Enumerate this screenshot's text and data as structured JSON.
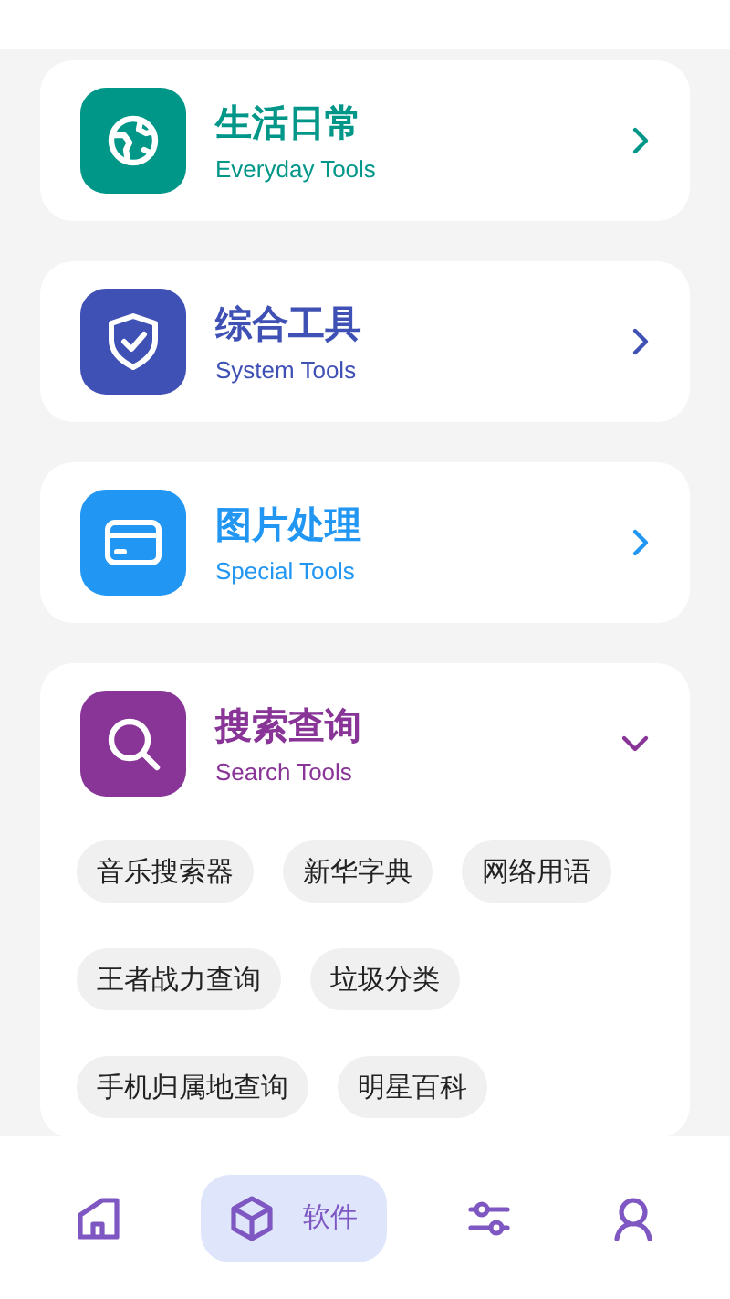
{
  "categories": [
    {
      "kind": "globe",
      "title": "生活日常",
      "subtitle": "Everyday Tools",
      "color": "#009688",
      "expanded": false
    },
    {
      "kind": "shield",
      "title": "综合工具",
      "subtitle": "System Tools",
      "color": "#3f51b5",
      "expanded": false
    },
    {
      "kind": "card",
      "title": "图片处理",
      "subtitle": "Special Tools",
      "color": "#2196f3",
      "expanded": false
    },
    {
      "kind": "search",
      "title": "搜索查询",
      "subtitle": "Search Tools",
      "color": "#883597",
      "expanded": true,
      "tools": [
        "音乐搜索器",
        "新华字典",
        "网络用语",
        "王者战力查询",
        "垃圾分类",
        "手机归属地查询",
        "明星百科"
      ]
    }
  ],
  "nav": [
    {
      "kind": "home",
      "selected": false
    },
    {
      "kind": "box",
      "selected": true,
      "label": "软件"
    },
    {
      "kind": "sliders",
      "selected": false
    },
    {
      "kind": "user",
      "selected": false
    }
  ]
}
